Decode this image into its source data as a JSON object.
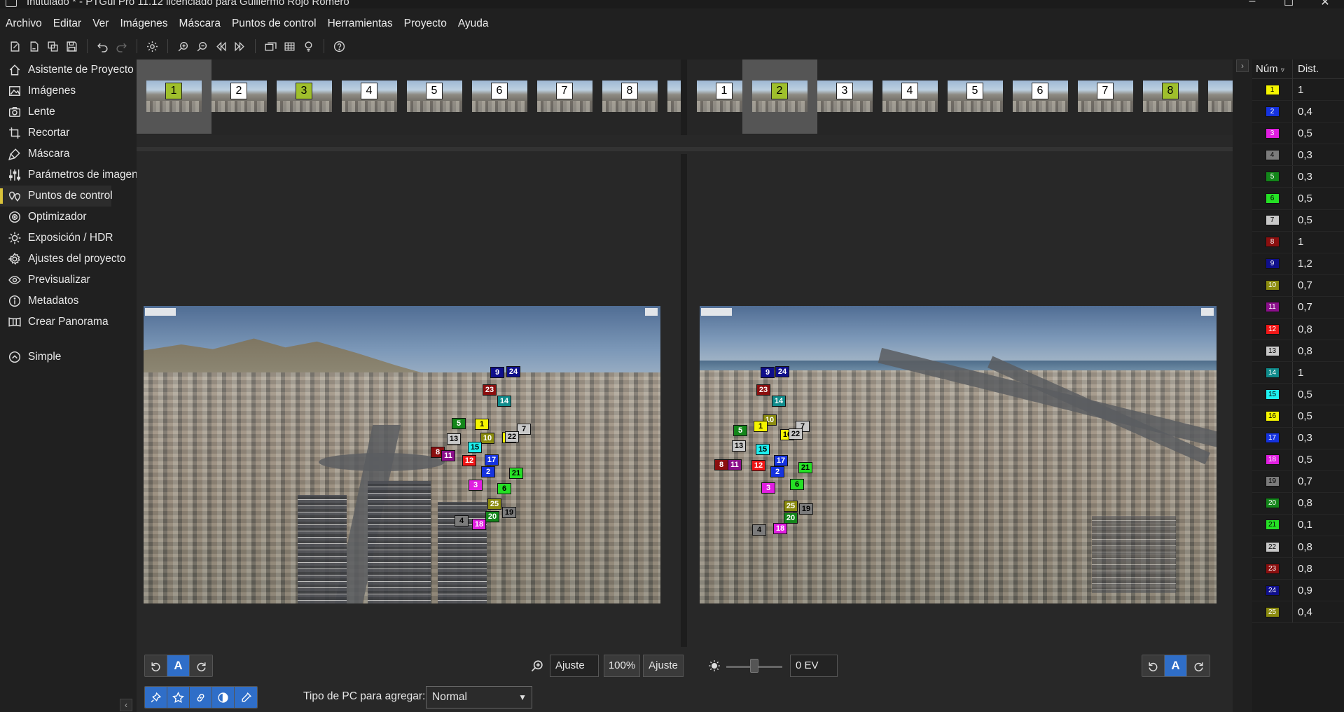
{
  "window": {
    "title": "Intitulado * - PTGui Pro 11.12 licenciado para Guillermo Rojo Romero",
    "controls": [
      "–",
      "☐",
      "✕"
    ]
  },
  "menu": [
    "Archivo",
    "Editar",
    "Ver",
    "Imágenes",
    "Máscara",
    "Puntos de control",
    "Herramientas",
    "Proyecto",
    "Ayuda"
  ],
  "toolbar_icons": [
    "new-project-icon",
    "open-project-icon",
    "save-as-icon",
    "save-icon",
    "undo-icon",
    "redo-icon",
    "settings-icon",
    "zoom-in-icon",
    "zoom-out-icon",
    "previous-icon",
    "next-icon",
    "panorama-editor-icon",
    "table-icon",
    "light-icon",
    "help-icon"
  ],
  "sidebar": {
    "items": [
      {
        "label": "Asistente de Proyecto",
        "icon": "home-icon"
      },
      {
        "label": "Imágenes",
        "icon": "images-icon"
      },
      {
        "label": "Lente",
        "icon": "camera-icon"
      },
      {
        "label": "Recortar",
        "icon": "crop-icon"
      },
      {
        "label": "Máscara",
        "icon": "mask-brush-icon"
      },
      {
        "label": "Parámetros de imagen",
        "icon": "sliders-icon"
      },
      {
        "label": "Puntos de control",
        "icon": "control-points-icon",
        "active": true
      },
      {
        "label": "Optimizador",
        "icon": "optimizer-icon"
      },
      {
        "label": "Exposición / HDR",
        "icon": "sun-icon"
      },
      {
        "label": "Ajustes del proyecto",
        "icon": "gear-icon"
      },
      {
        "label": "Previsualizar",
        "icon": "eye-icon"
      },
      {
        "label": "Metadatos",
        "icon": "info-icon"
      },
      {
        "label": "Crear Panorama",
        "icon": "panorama-icon"
      }
    ],
    "mode": {
      "label": "Simple",
      "icon": "chevron-up-circle-icon"
    }
  },
  "strip_left": {
    "thumbs": [
      "1",
      "2",
      "3",
      "4",
      "5",
      "6",
      "7",
      "8"
    ],
    "selected": "1",
    "highlighted": [
      "1",
      "3"
    ]
  },
  "strip_right": {
    "thumbs": [
      "1",
      "2",
      "3",
      "4",
      "5",
      "6",
      "7",
      "8"
    ],
    "selected": "2",
    "highlighted": [
      "2",
      "8"
    ]
  },
  "control_points_left": [
    "9",
    "24",
    "23",
    "14",
    "5",
    "1",
    "7",
    "13",
    "10",
    "16",
    "22",
    "15",
    "8",
    "11",
    "12",
    "17",
    "2",
    "21",
    "3",
    "6",
    "25",
    "19",
    "20",
    "4",
    "18"
  ],
  "control_points_right": [
    "9",
    "24",
    "23",
    "14",
    "10",
    "5",
    "1",
    "7",
    "16",
    "22",
    "13",
    "15",
    "17",
    "8",
    "11",
    "12",
    "2",
    "21",
    "3",
    "6",
    "25",
    "19",
    "20",
    "4",
    "18"
  ],
  "bottom": {
    "zoom_fit_field": "Ajuste",
    "zoom_100": "100%",
    "zoom_fit_button": "Ajuste",
    "exposure_value": "0 EV",
    "cp_type_label": "Tipo de PC para agregar:",
    "cp_type_value": "Normal",
    "auto_label": "A"
  },
  "table": {
    "header_num": "Núm",
    "header_dist": "Dist.",
    "rows": [
      {
        "num": "1",
        "dist": "1",
        "color": "#f5f500"
      },
      {
        "num": "2",
        "dist": "0,4",
        "color": "#1533e0"
      },
      {
        "num": "3",
        "dist": "0,5",
        "color": "#e01ee0"
      },
      {
        "num": "4",
        "dist": "0,3",
        "color": "#7b7b7b"
      },
      {
        "num": "5",
        "dist": "0,3",
        "color": "#13861a"
      },
      {
        "num": "6",
        "dist": "0,5",
        "color": "#25e025"
      },
      {
        "num": "7",
        "dist": "0,5",
        "color": "#c8c8c8"
      },
      {
        "num": "8",
        "dist": "1",
        "color": "#8b0f0f"
      },
      {
        "num": "9",
        "dist": "1,2",
        "color": "#0f0f8b"
      },
      {
        "num": "10",
        "dist": "0,7",
        "color": "#8b8b0f"
      },
      {
        "num": "11",
        "dist": "0,7",
        "color": "#8b0f8b"
      },
      {
        "num": "12",
        "dist": "0,8",
        "color": "#f01717"
      },
      {
        "num": "13",
        "dist": "0,8",
        "color": "#c8c8c8"
      },
      {
        "num": "14",
        "dist": "1",
        "color": "#0f8b8b"
      },
      {
        "num": "15",
        "dist": "0,5",
        "color": "#1ef0f0"
      },
      {
        "num": "16",
        "dist": "0,5",
        "color": "#f5f500"
      },
      {
        "num": "17",
        "dist": "0,3",
        "color": "#1533e0"
      },
      {
        "num": "18",
        "dist": "0,5",
        "color": "#e01ee0"
      },
      {
        "num": "19",
        "dist": "0,7",
        "color": "#7b7b7b"
      },
      {
        "num": "20",
        "dist": "0,8",
        "color": "#13861a"
      },
      {
        "num": "21",
        "dist": "0,1",
        "color": "#25e025"
      },
      {
        "num": "22",
        "dist": "0,8",
        "color": "#c8c8c8"
      },
      {
        "num": "23",
        "dist": "0,8",
        "color": "#8b0f0f"
      },
      {
        "num": "24",
        "dist": "0,9",
        "color": "#0f0f8b"
      },
      {
        "num": "25",
        "dist": "0,4",
        "color": "#8b8b0f"
      }
    ]
  }
}
